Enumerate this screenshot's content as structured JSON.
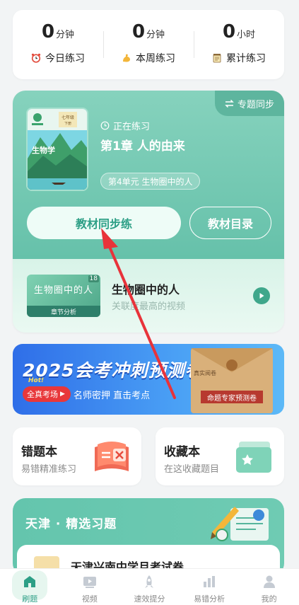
{
  "stats": [
    {
      "value": "0",
      "unit": "分钟",
      "label": "今日练习",
      "icon": "alarm-clock-icon"
    },
    {
      "value": "0",
      "unit": "分钟",
      "label": "本周练习",
      "icon": "flexed-bicep-icon"
    },
    {
      "value": "0",
      "unit": "小时",
      "label": "累计练习",
      "icon": "notepad-icon"
    }
  ],
  "textbook": {
    "sync_tag": "专题同步",
    "cover": {
      "subject": "生物学",
      "grade": "七年级",
      "volume": "下册"
    },
    "status": "正在练习",
    "chapter": "第1章  人的由来",
    "unit": "第4单元  生物圈中的人",
    "primary_button": "教材同步练",
    "secondary_button": "教材目录",
    "video": {
      "thumb_title": "生物圈中的人",
      "thumb_badge": "18",
      "thumb_caption": "章节分析",
      "title": "生物圈中的人",
      "subtitle": "关联度最高的视频"
    }
  },
  "banner": {
    "title": "2025会考冲刺预测卷",
    "hot_text": "Hot!",
    "chip": "全真考场",
    "subtitle": "名师密押 直击考点",
    "envelope_label": "命题专家预测卷",
    "envelope_stamp": "真实阅卷"
  },
  "cards": [
    {
      "title": "错题本",
      "subtitle": "易错精准练习",
      "icon": "error-book-icon"
    },
    {
      "title": "收藏本",
      "subtitle": "在这收藏题目",
      "icon": "favorite-folder-icon"
    }
  ],
  "region": {
    "title": "天津 · 精选习题",
    "item": "天津兴南中学月考试卷"
  },
  "nav": [
    {
      "label": "刷题",
      "icon": "home-icon",
      "active": true
    },
    {
      "label": "视频",
      "icon": "video-icon",
      "active": false
    },
    {
      "label": "速效提分",
      "icon": "rocket-icon",
      "active": false
    },
    {
      "label": "易错分析",
      "icon": "bar-chart-icon",
      "active": false
    },
    {
      "label": "我的",
      "icon": "user-icon",
      "active": false
    }
  ],
  "colors": {
    "accent": "#2d9f86",
    "card_top": "#7acbb5",
    "banner": "#3b82ee",
    "annotation": "#e8333a"
  }
}
